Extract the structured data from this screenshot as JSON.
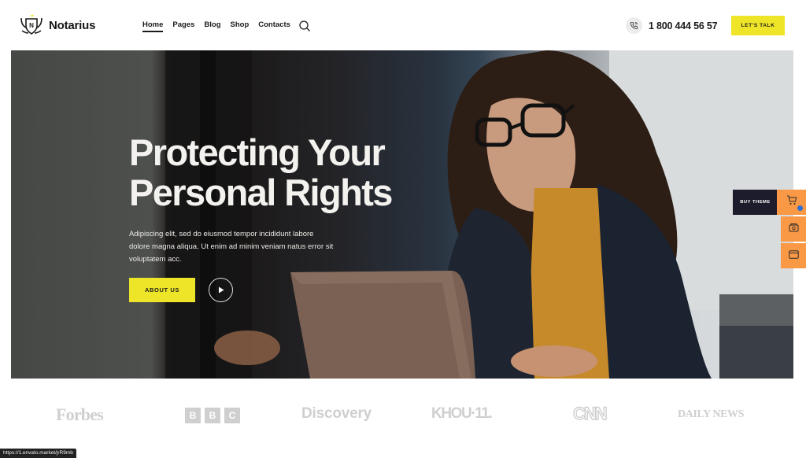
{
  "header": {
    "brand": "Notarius",
    "logo_icon": "shield-crest-icon",
    "nav": [
      {
        "label": "Home",
        "active": true
      },
      {
        "label": "Pages",
        "active": false
      },
      {
        "label": "Blog",
        "active": false
      },
      {
        "label": "Shop",
        "active": false
      },
      {
        "label": "Contacts",
        "active": false
      }
    ],
    "search_icon": "search-icon",
    "phone_icon": "phone-icon",
    "phone": "1 800 444 56 57",
    "cta_label": "LET'S TALK"
  },
  "hero": {
    "title_line1": "Protecting Your",
    "title_line2": "Personal Rights",
    "description": "Adipiscing elit, sed do eiusmod tempor incididunt labore dolore magna aliqua. Ut enim ad minim veniam natus error sit voluptatem acc.",
    "primary_button": "ABOUT US",
    "play_icon": "play-icon"
  },
  "side_panel": {
    "buy_label": "BUY THEME",
    "items": [
      {
        "icon": "cart-icon"
      },
      {
        "icon": "portfolio-icon"
      },
      {
        "icon": "browser-window-icon"
      }
    ]
  },
  "partners": {
    "logos": [
      "Forbes",
      "BBC",
      "Discovery",
      "KHOU·11.",
      "CNN",
      "DAILY NEWS"
    ]
  },
  "status_bar": {
    "url": "https://1.envato.market/jrR9mb"
  },
  "colors": {
    "accent_yellow": "#efe528",
    "side_orange": "#f99845",
    "buy_dark": "#1c1c2c",
    "logo_gray": "#cfcfcf"
  }
}
